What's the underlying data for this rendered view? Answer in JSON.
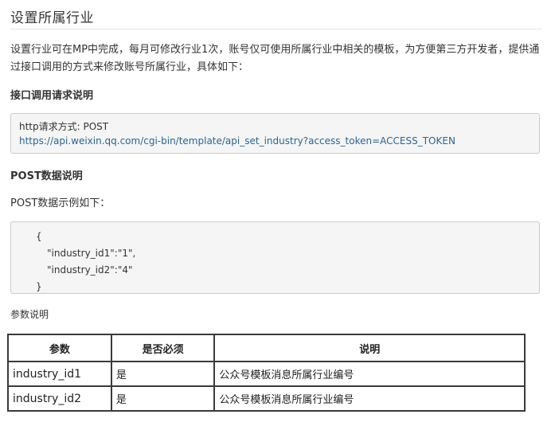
{
  "title": "设置所属行业",
  "intro": "设置行业可在MP中完成，每月可修改行业1次，账号仅可使用所属行业中相关的模板，为方便第三方开发者，提供通过接口调用的方式来修改账号所属行业，具体如下：",
  "request_section": {
    "heading": "接口调用请求说明",
    "method_line": "http请求方式: POST",
    "url": "https://api.weixin.qq.com/cgi-bin/template/api_set_industry?access_token=ACCESS_TOKEN"
  },
  "post_section": {
    "heading": "POST数据说明",
    "subheading": "POST数据示例如下：",
    "json_lines": [
      "{",
      "\"industry_id1\":\"1\",",
      "\"industry_id2\":\"4\"",
      "}"
    ]
  },
  "params": {
    "label": "参数说明",
    "headers": [
      "参数",
      "是否必须",
      "说明"
    ],
    "rows": [
      [
        "industry_id1",
        "是",
        "公众号模板消息所属行业编号"
      ],
      [
        "industry_id2",
        "是",
        "公众号模板消息所属行业编号"
      ]
    ]
  }
}
